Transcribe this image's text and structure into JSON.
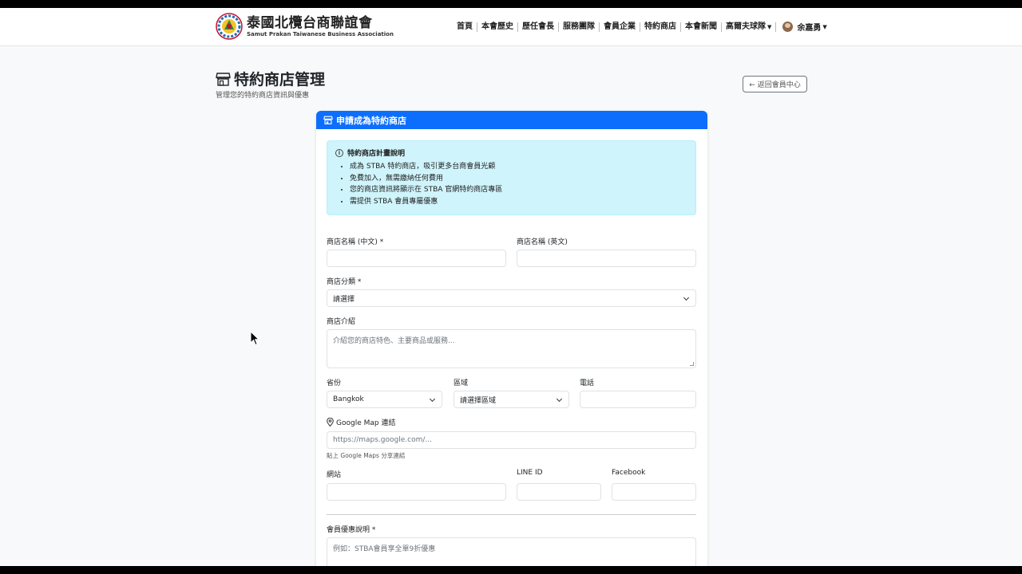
{
  "brand": {
    "title": "泰國北欖台商聯誼會",
    "subtitle": "Samut Prakan Taiwanese Business Association"
  },
  "nav": {
    "items": [
      "首頁",
      "本會歷史",
      "歷任會長",
      "服務團隊",
      "會員企業",
      "特約商店",
      "本會新聞"
    ],
    "golf": "高爾夫球隊",
    "user": "余嘉勇"
  },
  "page": {
    "title": "特約商店管理",
    "subtitle": "管理您的特約商店資訊與優惠",
    "back_button": "← 返回會員中心"
  },
  "card": {
    "title": "申請成為特約商店",
    "accent": "#0d6efd"
  },
  "notice": {
    "title": "特約商店計畫說明",
    "items": [
      "成為 STBA 特約商店，吸引更多台商會員光顧",
      "免費加入，無需繳納任何費用",
      "您的商店資訊將顯示在 STBA 官網特約商店專區",
      "需提供 STBA 會員專屬優惠"
    ]
  },
  "form": {
    "name_zh_label": "商店名稱 (中文) *",
    "name_en_label": "商店名稱 (英文)",
    "category_label": "商店分類 *",
    "category_value": "請選擇",
    "intro_label": "商店介紹",
    "intro_placeholder": "介紹您的商店特色、主要商品或服務...",
    "province_label": "省份",
    "province_value": "Bangkok",
    "district_label": "區域",
    "district_value": "請選擇區域",
    "phone_label": "電話",
    "map_label": "Google Map 連結",
    "map_placeholder": "https://maps.google.com/...",
    "map_hint": "貼上 Google Maps 分享連結",
    "website_label": "網站",
    "line_label": "LINE ID",
    "facebook_label": "Facebook",
    "offer_label": "會員優惠說明 *",
    "offer_placeholder": "例如：STBA會員享全單9折優惠"
  }
}
